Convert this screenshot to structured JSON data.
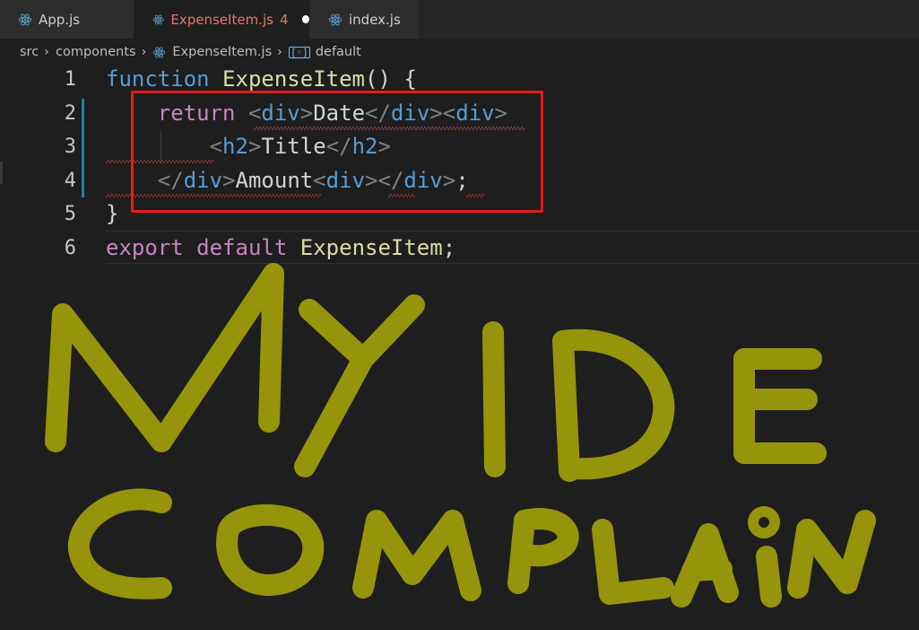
{
  "tabs": [
    {
      "label": "App.js",
      "icon": "react-icon",
      "active": false
    },
    {
      "label": "ExpenseItem.js",
      "icon": "react-icon",
      "active": true,
      "problems": "4",
      "modified": true
    },
    {
      "label": "index.js",
      "icon": "react-icon",
      "active": false
    }
  ],
  "breadcrumb": {
    "parts": [
      "src",
      "components",
      "ExpenseItem.js",
      "default"
    ],
    "symbol_icon": "symbol-variable-icon"
  },
  "editor": {
    "line_numbers": [
      "1",
      "2",
      "3",
      "4",
      "5",
      "6"
    ],
    "lines": [
      [
        {
          "t": "function",
          "c": "kw-blue"
        },
        {
          "t": " ",
          "c": "txt"
        },
        {
          "t": "ExpenseItem",
          "c": "fn"
        },
        {
          "t": "() {",
          "c": "punc"
        }
      ],
      [
        {
          "t": "    ",
          "c": "txt"
        },
        {
          "t": "return",
          "c": "kw-pink"
        },
        {
          "t": " ",
          "c": "txt"
        },
        {
          "t": "<",
          "c": "ang"
        },
        {
          "t": "div",
          "c": "tag"
        },
        {
          "t": ">",
          "c": "ang"
        },
        {
          "t": "Date",
          "c": "txt"
        },
        {
          "t": "</",
          "c": "ang"
        },
        {
          "t": "div",
          "c": "tag"
        },
        {
          "t": ">",
          "c": "ang"
        },
        {
          "t": "<",
          "c": "ang"
        },
        {
          "t": "div",
          "c": "tag"
        },
        {
          "t": ">",
          "c": "ang"
        }
      ],
      [
        {
          "t": "        ",
          "c": "txt"
        },
        {
          "t": "<",
          "c": "ang"
        },
        {
          "t": "h2",
          "c": "tag"
        },
        {
          "t": ">",
          "c": "ang"
        },
        {
          "t": "Title",
          "c": "txt"
        },
        {
          "t": "</",
          "c": "ang"
        },
        {
          "t": "h2",
          "c": "tag"
        },
        {
          "t": ">",
          "c": "ang"
        }
      ],
      [
        {
          "t": "    ",
          "c": "txt"
        },
        {
          "t": "</",
          "c": "ang"
        },
        {
          "t": "div",
          "c": "tag"
        },
        {
          "t": ">",
          "c": "ang"
        },
        {
          "t": "Amount",
          "c": "txt"
        },
        {
          "t": "<",
          "c": "ang"
        },
        {
          "t": "div",
          "c": "tag"
        },
        {
          "t": ">",
          "c": "ang"
        },
        {
          "t": "</",
          "c": "ang"
        },
        {
          "t": "div",
          "c": "tag"
        },
        {
          "t": ">",
          "c": "ang"
        },
        {
          "t": ";",
          "c": "punc"
        }
      ],
      [
        {
          "t": "}",
          "c": "punc"
        }
      ],
      [
        {
          "t": "export",
          "c": "kw-pink"
        },
        {
          "t": " ",
          "c": "txt"
        },
        {
          "t": "default",
          "c": "kw-pink"
        },
        {
          "t": " ",
          "c": "txt"
        },
        {
          "t": "ExpenseItem",
          "c": "fn"
        },
        {
          "t": ";",
          "c": "punc"
        }
      ]
    ]
  },
  "annotation": {
    "handwritten_text": "MY IDE COMPLAIN",
    "color": "#9c9b0b",
    "box_color": "#e51b1b"
  },
  "colors": {
    "background": "#1e1e1e",
    "tab_bar": "#252526",
    "error": "#f14c4c",
    "modified_tab": "#e8766a"
  }
}
